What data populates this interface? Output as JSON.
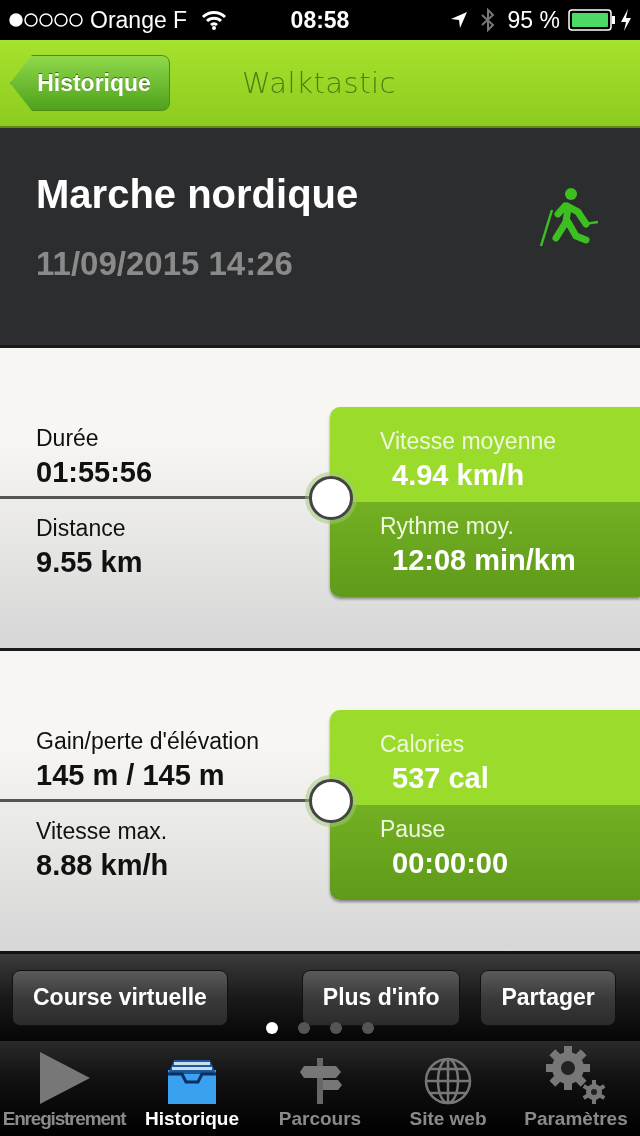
{
  "status_bar": {
    "carrier": "Orange F",
    "time": "08:58",
    "battery": "95 %"
  },
  "nav": {
    "back": "Historique",
    "title": "Walktastic"
  },
  "activity": {
    "name": "Marche nordique",
    "datetime": "11/09/2015 14:26"
  },
  "panels": [
    {
      "left": [
        {
          "label": "Durée",
          "value": "01:55:56"
        },
        {
          "label": "Distance",
          "value": "9.55 km"
        }
      ],
      "right": [
        {
          "label": "Vitesse moyenne",
          "value": "4.94 km/h"
        },
        {
          "label": "Rythme moy.",
          "value": "12:08 min/km"
        }
      ]
    },
    {
      "left": [
        {
          "label": "Gain/perte d'élévation",
          "value": "145 m / 145 m"
        },
        {
          "label": "Vitesse max.",
          "value": "8.88 km/h"
        }
      ],
      "right": [
        {
          "label": "Calories",
          "value": "537 cal"
        },
        {
          "label": "Pause",
          "value": "00:00:00"
        }
      ]
    }
  ],
  "actions": [
    "Course virtuelle",
    "Plus d'info",
    "Partager"
  ],
  "pager": [
    {
      "selected": true
    },
    {
      "selected": false
    },
    {
      "selected": false
    },
    {
      "selected": false
    }
  ],
  "tabs": [
    {
      "label": "Enregistrement",
      "selected": false
    },
    {
      "label": "Historique",
      "selected": true
    },
    {
      "label": "Parcours",
      "selected": false
    },
    {
      "label": "Site web",
      "selected": false
    },
    {
      "label": "Paramètres",
      "selected": false
    }
  ]
}
